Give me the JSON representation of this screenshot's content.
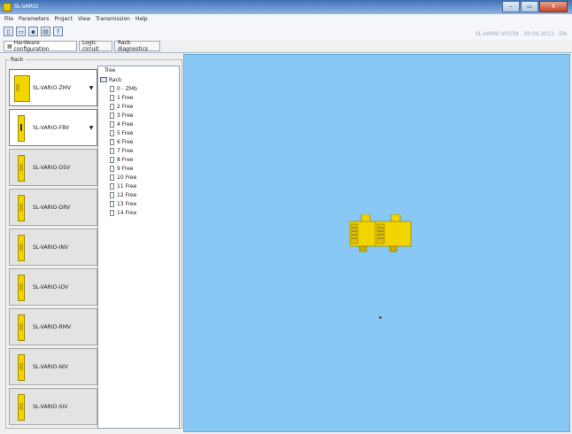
{
  "window": {
    "title": "SL-VARIO",
    "minimize_label": "–",
    "maximize_label": "▭",
    "close_label": "X"
  },
  "menu": [
    "File",
    "Parameters",
    "Project",
    "View",
    "Transmission",
    "Help"
  ],
  "toolbar": {
    "buttons": [
      {
        "name": "new-icon",
        "glyph": "▯"
      },
      {
        "name": "open-folder-icon",
        "glyph": "▭"
      },
      {
        "name": "save-icon",
        "glyph": "▪"
      },
      {
        "name": "print-icon",
        "glyph": "▤"
      },
      {
        "name": "help-icon",
        "glyph": "?"
      }
    ],
    "version": "SL-VARIO V0339 - 30.09.2013 - EN"
  },
  "tabs": [
    {
      "label": "Hardware configuration",
      "icon": "hardware-icon",
      "active": true
    },
    {
      "label": "Logic circuit",
      "active": false
    },
    {
      "label": "Rack diagnostics",
      "active": false
    }
  ],
  "rack": {
    "label": "Rack",
    "modules": [
      {
        "name": "SL-VARIO-ZMV",
        "selected": true,
        "dropdown": true,
        "icon": "wide"
      },
      {
        "name": "SL-VARIO-FBV",
        "selected": true,
        "dropdown": true,
        "icon": "dark"
      },
      {
        "name": "SL-VARIO-DSV",
        "selected": false,
        "dropdown": false,
        "icon": "normal"
      },
      {
        "name": "SL-VARIO-DRV",
        "selected": false,
        "dropdown": false,
        "icon": "normal"
      },
      {
        "name": "SL-VARIO-INV",
        "selected": false,
        "dropdown": false,
        "icon": "normal"
      },
      {
        "name": "SL-VARIO-IOV",
        "selected": false,
        "dropdown": false,
        "icon": "normal"
      },
      {
        "name": "SL-VARIO-RMV",
        "selected": false,
        "dropdown": false,
        "icon": "normal"
      },
      {
        "name": "SL-VARIO-NIV",
        "selected": false,
        "dropdown": false,
        "icon": "normal"
      },
      {
        "name": "SL-VARIO-SIV",
        "selected": false,
        "dropdown": false,
        "icon": "normal"
      }
    ]
  },
  "tree": {
    "label": "Tree",
    "root": "Rack",
    "items": [
      "0 - ZMb",
      "1 Free",
      "2 Free",
      "3 Free",
      "4 Free",
      "5 Free",
      "6 Free",
      "7 Free",
      "8 Free",
      "9 Free",
      "10 Free",
      "11 Free",
      "12 Free",
      "13 Free",
      "14 Free"
    ]
  },
  "colors": {
    "workspace": "#88c8f4",
    "module_yellow": "#f2d400",
    "titlebar": "#3d6fb3"
  }
}
